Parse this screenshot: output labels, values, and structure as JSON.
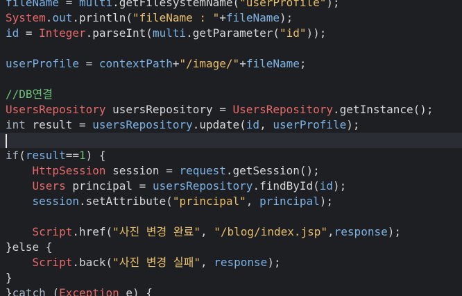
{
  "editor": {
    "caret_line": 9,
    "lines": [
      [
        {
          "t": "fileName",
          "c": "var"
        },
        {
          "t": " = ",
          "c": "punct"
        },
        {
          "t": "multi",
          "c": "var"
        },
        {
          "t": ".getFilesystemName(",
          "c": "method"
        },
        {
          "t": "\"userProfile\"",
          "c": "string"
        },
        {
          "t": ");",
          "c": "punct"
        }
      ],
      [
        {
          "t": "System",
          "c": "type"
        },
        {
          "t": ".",
          "c": "punct"
        },
        {
          "t": "out",
          "c": "var"
        },
        {
          "t": ".println(",
          "c": "method"
        },
        {
          "t": "\"fileName : \"",
          "c": "string"
        },
        {
          "t": "+",
          "c": "punct"
        },
        {
          "t": "fileName",
          "c": "var"
        },
        {
          "t": ");",
          "c": "punct"
        }
      ],
      [
        {
          "t": "id",
          "c": "var"
        },
        {
          "t": " = ",
          "c": "punct"
        },
        {
          "t": "Integer",
          "c": "type"
        },
        {
          "t": ".parseInt(",
          "c": "method"
        },
        {
          "t": "multi",
          "c": "var"
        },
        {
          "t": ".getParameter(",
          "c": "method"
        },
        {
          "t": "\"id\"",
          "c": "string"
        },
        {
          "t": "));",
          "c": "punct"
        }
      ],
      [],
      [
        {
          "t": "userProfile",
          "c": "var"
        },
        {
          "t": " = ",
          "c": "punct"
        },
        {
          "t": "contextPath",
          "c": "var"
        },
        {
          "t": "+",
          "c": "punct"
        },
        {
          "t": "\"/image/\"",
          "c": "string"
        },
        {
          "t": "+",
          "c": "punct"
        },
        {
          "t": "fileName",
          "c": "var"
        },
        {
          "t": ";",
          "c": "punct"
        }
      ],
      [],
      [
        {
          "t": "//DB연결",
          "c": "comment"
        }
      ],
      [
        {
          "t": "UsersRepository",
          "c": "type"
        },
        {
          "t": " usersRepository = ",
          "c": "default"
        },
        {
          "t": "UsersRepository",
          "c": "type"
        },
        {
          "t": ".getInstance();",
          "c": "method"
        }
      ],
      [
        {
          "t": "int",
          "c": "keyword"
        },
        {
          "t": " result = ",
          "c": "default"
        },
        {
          "t": "usersRepository",
          "c": "var"
        },
        {
          "t": ".update(",
          "c": "method"
        },
        {
          "t": "id",
          "c": "var"
        },
        {
          "t": ", ",
          "c": "punct"
        },
        {
          "t": "userProfile",
          "c": "var"
        },
        {
          "t": ");",
          "c": "punct"
        }
      ],
      [],
      [
        {
          "t": "if",
          "c": "keyword"
        },
        {
          "t": "(",
          "c": "punct"
        },
        {
          "t": "result",
          "c": "var"
        },
        {
          "t": "==",
          "c": "punct"
        },
        {
          "t": "1",
          "c": "number"
        },
        {
          "t": ") {",
          "c": "punct"
        }
      ],
      [
        {
          "t": "    ",
          "c": "default"
        },
        {
          "t": "HttpSession",
          "c": "type"
        },
        {
          "t": " session = ",
          "c": "default"
        },
        {
          "t": "request",
          "c": "var"
        },
        {
          "t": ".getSession();",
          "c": "method"
        }
      ],
      [
        {
          "t": "    ",
          "c": "default"
        },
        {
          "t": "Users",
          "c": "type"
        },
        {
          "t": " principal = ",
          "c": "default"
        },
        {
          "t": "usersRepository",
          "c": "var"
        },
        {
          "t": ".findById(",
          "c": "method"
        },
        {
          "t": "id",
          "c": "var"
        },
        {
          "t": ");",
          "c": "punct"
        }
      ],
      [
        {
          "t": "    ",
          "c": "default"
        },
        {
          "t": "session",
          "c": "var"
        },
        {
          "t": ".setAttribute(",
          "c": "method"
        },
        {
          "t": "\"principal\"",
          "c": "string"
        },
        {
          "t": ", ",
          "c": "punct"
        },
        {
          "t": "principal",
          "c": "var"
        },
        {
          "t": ");",
          "c": "punct"
        }
      ],
      [],
      [
        {
          "t": "    ",
          "c": "default"
        },
        {
          "t": "Script",
          "c": "type"
        },
        {
          "t": ".href(",
          "c": "method"
        },
        {
          "t": "\"사진 변경 완료\"",
          "c": "string"
        },
        {
          "t": ", ",
          "c": "punct"
        },
        {
          "t": "\"/blog/index.jsp\"",
          "c": "string"
        },
        {
          "t": ",",
          "c": "punct"
        },
        {
          "t": "response",
          "c": "var"
        },
        {
          "t": ");",
          "c": "punct"
        }
      ],
      [
        {
          "t": "}else {",
          "c": "punct"
        }
      ],
      [
        {
          "t": "    ",
          "c": "default"
        },
        {
          "t": "Script",
          "c": "type"
        },
        {
          "t": ".back(",
          "c": "method"
        },
        {
          "t": "\"사진 변경 실패\"",
          "c": "string"
        },
        {
          "t": ", ",
          "c": "punct"
        },
        {
          "t": "response",
          "c": "var"
        },
        {
          "t": ");",
          "c": "punct"
        }
      ],
      [
        {
          "t": "}",
          "c": "punct"
        }
      ],
      [
        {
          "t": "}",
          "c": "punct"
        },
        {
          "t": "catch",
          "c": "keyword"
        },
        {
          "t": " (",
          "c": "punct"
        },
        {
          "t": "Exception",
          "c": "type"
        },
        {
          "t": " e) {",
          "c": "default"
        }
      ]
    ]
  }
}
